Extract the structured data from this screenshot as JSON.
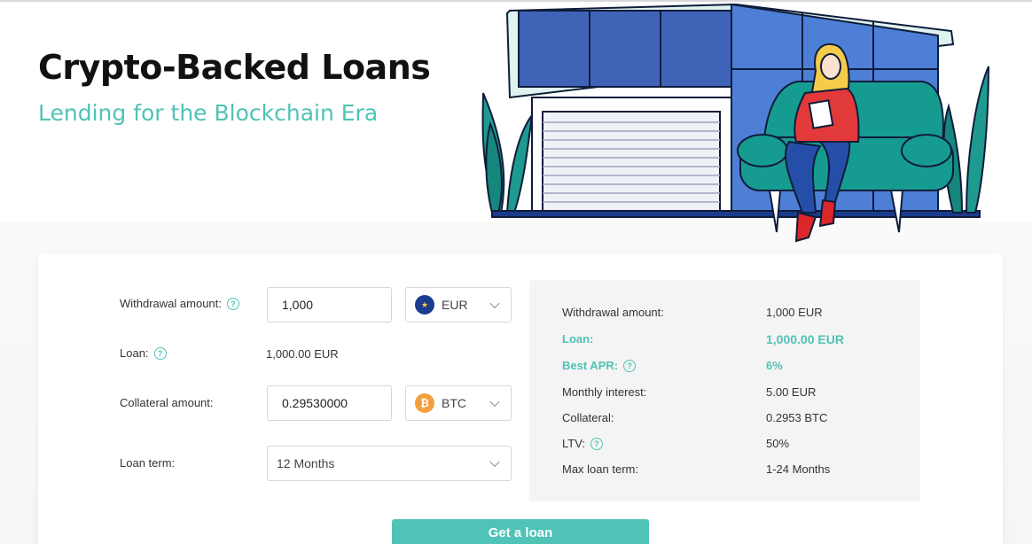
{
  "hero": {
    "title": "Crypto-Backed Loans",
    "subtitle": "Lending for the Blockchain Era"
  },
  "colors": {
    "accent": "#4fc3b6",
    "title": "#111111"
  },
  "form": {
    "withdrawal": {
      "label": "Withdrawal amount:",
      "value": "1,000",
      "currency": "EUR",
      "currency_icon": "euro-flag-icon"
    },
    "loan": {
      "label": "Loan:",
      "value": "1,000.00 EUR"
    },
    "collateral": {
      "label": "Collateral amount:",
      "value": "0.29530000",
      "currency": "BTC",
      "currency_icon": "bitcoin-icon"
    },
    "term": {
      "label": "Loan term:",
      "value": "12 Months"
    }
  },
  "summary": {
    "withdrawal": {
      "label": "Withdrawal amount:",
      "value": "1,000 EUR"
    },
    "loan": {
      "label": "Loan:",
      "value": "1,000.00 EUR"
    },
    "apr": {
      "label": "Best APR:",
      "value": "6%"
    },
    "interest": {
      "label": "Monthly interest:",
      "value": "5.00 EUR"
    },
    "collateral": {
      "label": "Collateral:",
      "value": "0.2953 BTC"
    },
    "ltv": {
      "label": "LTV:",
      "value": "50%"
    },
    "max_term": {
      "label": "Max loan term:",
      "value": "1-24 Months"
    }
  },
  "cta": {
    "label": "Get a loan"
  },
  "help_glyph": "?",
  "coins": {
    "eur_glyph": "★",
    "btc_glyph": "₿"
  }
}
